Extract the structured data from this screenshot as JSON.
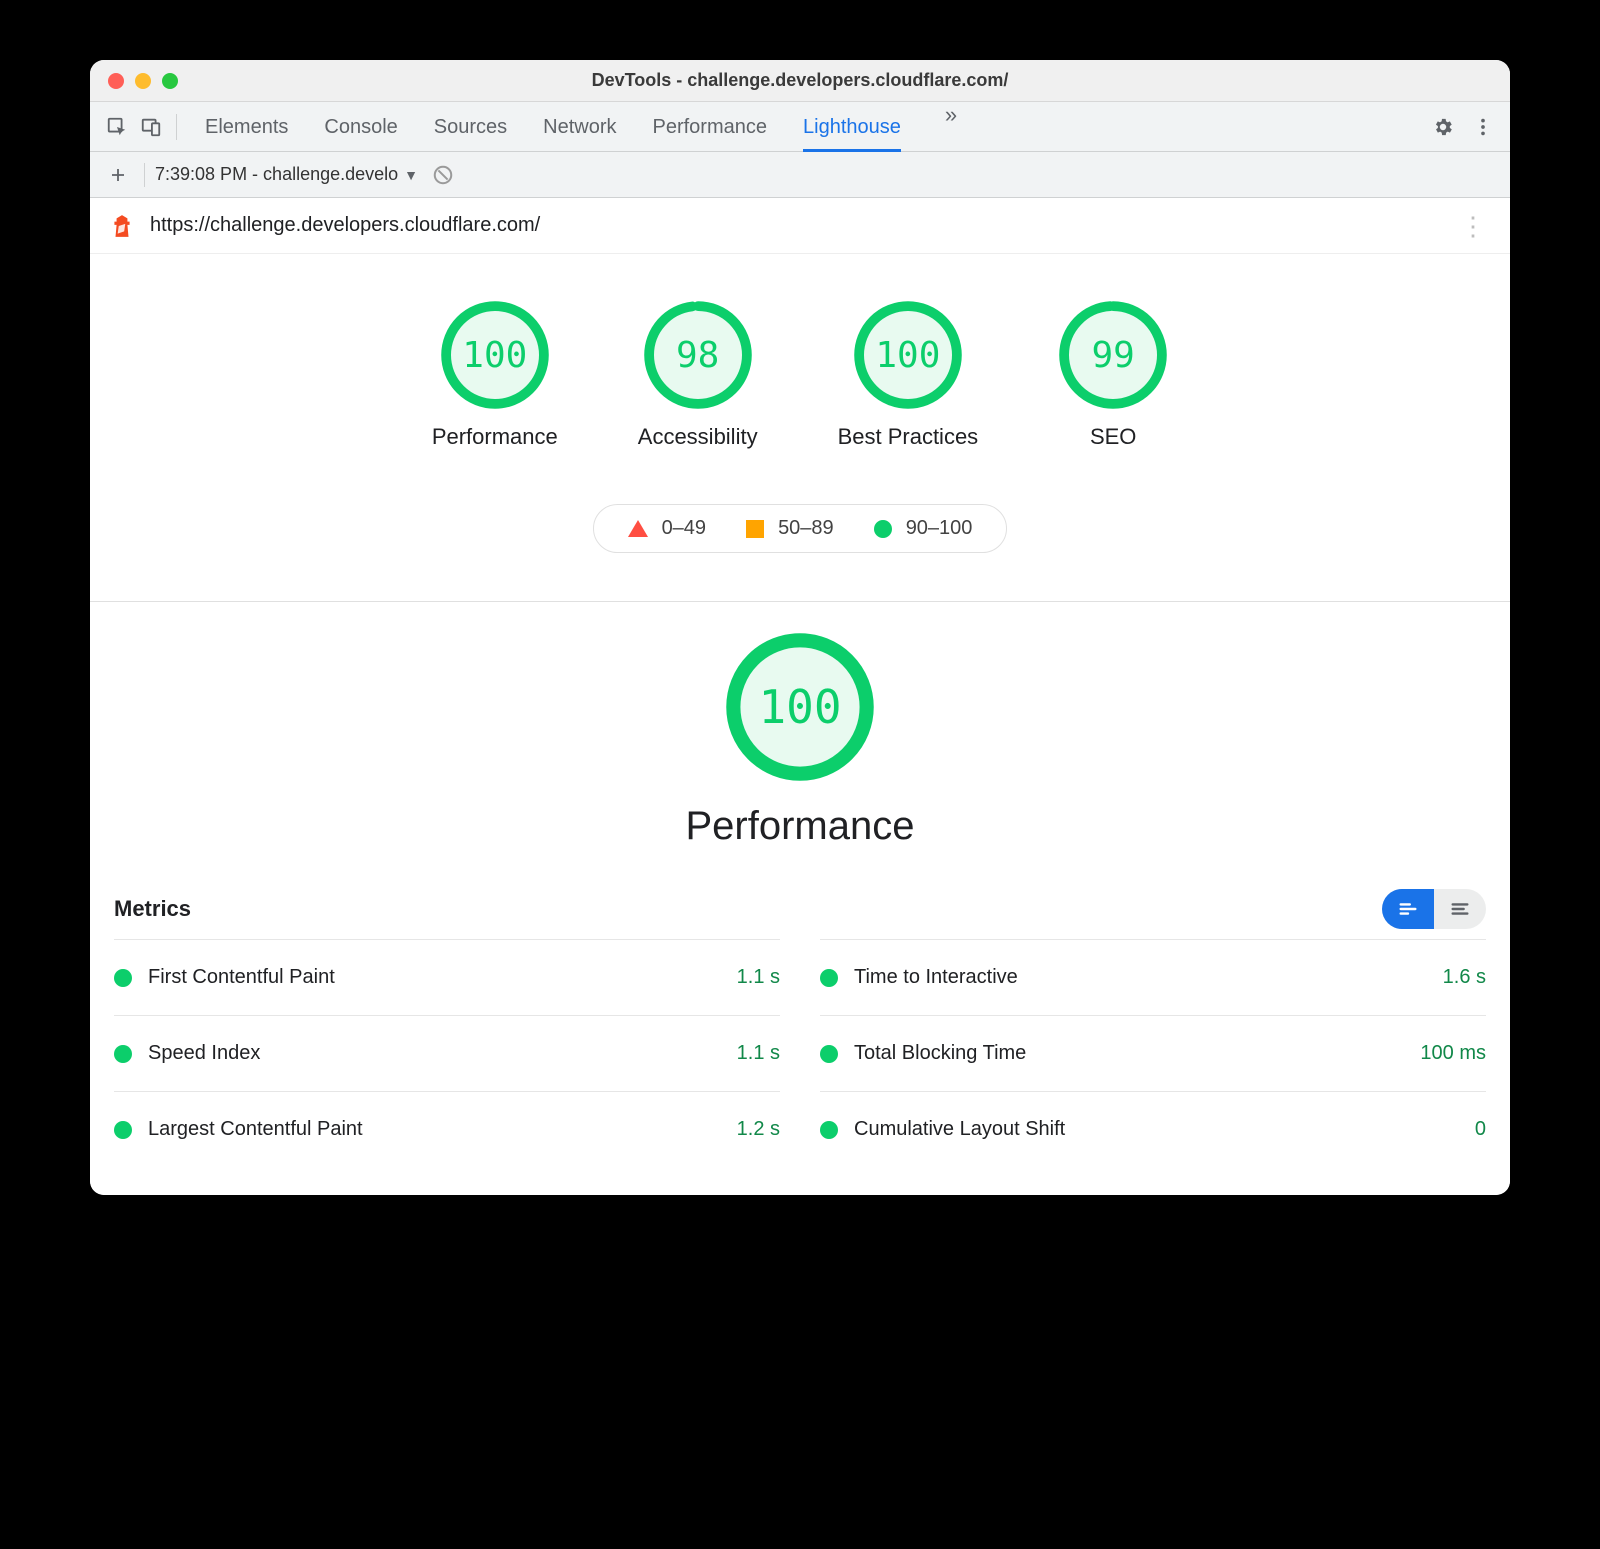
{
  "window": {
    "title": "DevTools - challenge.developers.cloudflare.com/"
  },
  "tabs": {
    "items": [
      "Elements",
      "Console",
      "Sources",
      "Network",
      "Performance",
      "Lighthouse"
    ],
    "active": "Lighthouse"
  },
  "subbar": {
    "report_label": "7:39:08 PM - challenge.develo"
  },
  "urlbar": {
    "url": "https://challenge.developers.cloudflare.com/"
  },
  "summary": {
    "gauges": [
      {
        "label": "Performance",
        "score": 100
      },
      {
        "label": "Accessibility",
        "score": 98
      },
      {
        "label": "Best Practices",
        "score": 100
      },
      {
        "label": "SEO",
        "score": 99
      }
    ],
    "legend": {
      "fail": "0–49",
      "average": "50–89",
      "pass": "90–100"
    }
  },
  "performance": {
    "score": 100,
    "title": "Performance",
    "metrics_heading": "Metrics",
    "metrics_left": [
      {
        "name": "First Contentful Paint",
        "value": "1.1 s"
      },
      {
        "name": "Speed Index",
        "value": "1.1 s"
      },
      {
        "name": "Largest Contentful Paint",
        "value": "1.2 s"
      }
    ],
    "metrics_right": [
      {
        "name": "Time to Interactive",
        "value": "1.6 s"
      },
      {
        "name": "Total Blocking Time",
        "value": "100 ms"
      },
      {
        "name": "Cumulative Layout Shift",
        "value": "0"
      }
    ]
  },
  "colors": {
    "pass": "#0cce6b",
    "average": "#ffa400",
    "fail": "#ff4e42",
    "active_tab": "#1a73e8"
  },
  "chart_data": [
    {
      "type": "pie",
      "title": "Performance",
      "categories": [
        "score",
        "remaining"
      ],
      "values": [
        100,
        0
      ],
      "ylim": [
        0,
        100
      ]
    },
    {
      "type": "pie",
      "title": "Accessibility",
      "categories": [
        "score",
        "remaining"
      ],
      "values": [
        98,
        2
      ],
      "ylim": [
        0,
        100
      ]
    },
    {
      "type": "pie",
      "title": "Best Practices",
      "categories": [
        "score",
        "remaining"
      ],
      "values": [
        100,
        0
      ],
      "ylim": [
        0,
        100
      ]
    },
    {
      "type": "pie",
      "title": "SEO",
      "categories": [
        "score",
        "remaining"
      ],
      "values": [
        99,
        1
      ],
      "ylim": [
        0,
        100
      ]
    },
    {
      "type": "pie",
      "title": "Performance",
      "categories": [
        "score",
        "remaining"
      ],
      "values": [
        100,
        0
      ],
      "ylim": [
        0,
        100
      ]
    }
  ]
}
